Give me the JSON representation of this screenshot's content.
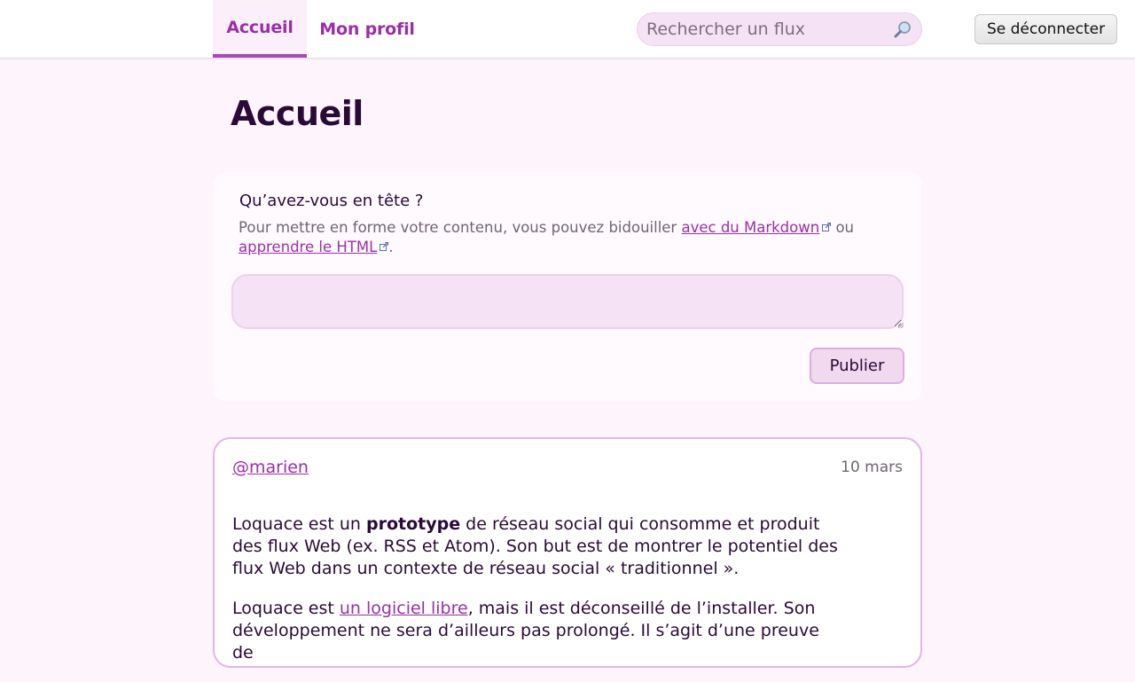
{
  "nav": {
    "home_label": "Accueil",
    "profile_label": "Mon profil",
    "search_placeholder": "Rechercher un flux",
    "logout_label": "Se déconnecter"
  },
  "page": {
    "title": "Accueil"
  },
  "compose": {
    "label": "Qu’avez-vous en tête ?",
    "hint_prefix": "Pour mettre en forme votre contenu, vous pouvez bidouiller ",
    "markdown_link": "avec du Markdown",
    "hint_middle": " ou",
    "html_link": "apprendre le HTML",
    "hint_suffix": ".",
    "textarea_value": "",
    "publish_label": "Publier"
  },
  "post": {
    "author": "@marien",
    "date": "10 mars",
    "p1_before": "Loquace est un ",
    "p1_bold": "prototype",
    "p1_after": " de réseau social qui consomme et produit des flux Web (ex. RSS et Atom). Son but est de montrer le potentiel des flux Web dans un contexte de réseau social « traditionnel ».",
    "p2_before": "Loquace est ",
    "p2_link": "un logiciel libre",
    "p2_after": ", mais il est déconseillé de l’installer. Son développement ne sera d’ailleurs pas prolongé. Il s’agit d’une preuve de"
  },
  "colors": {
    "accent": "#9b2fa8",
    "page_background": "#fdf4fc",
    "text": "#2a0a36"
  },
  "icons": {
    "search": "magnifier-icon",
    "external_link": "external-link-icon"
  }
}
